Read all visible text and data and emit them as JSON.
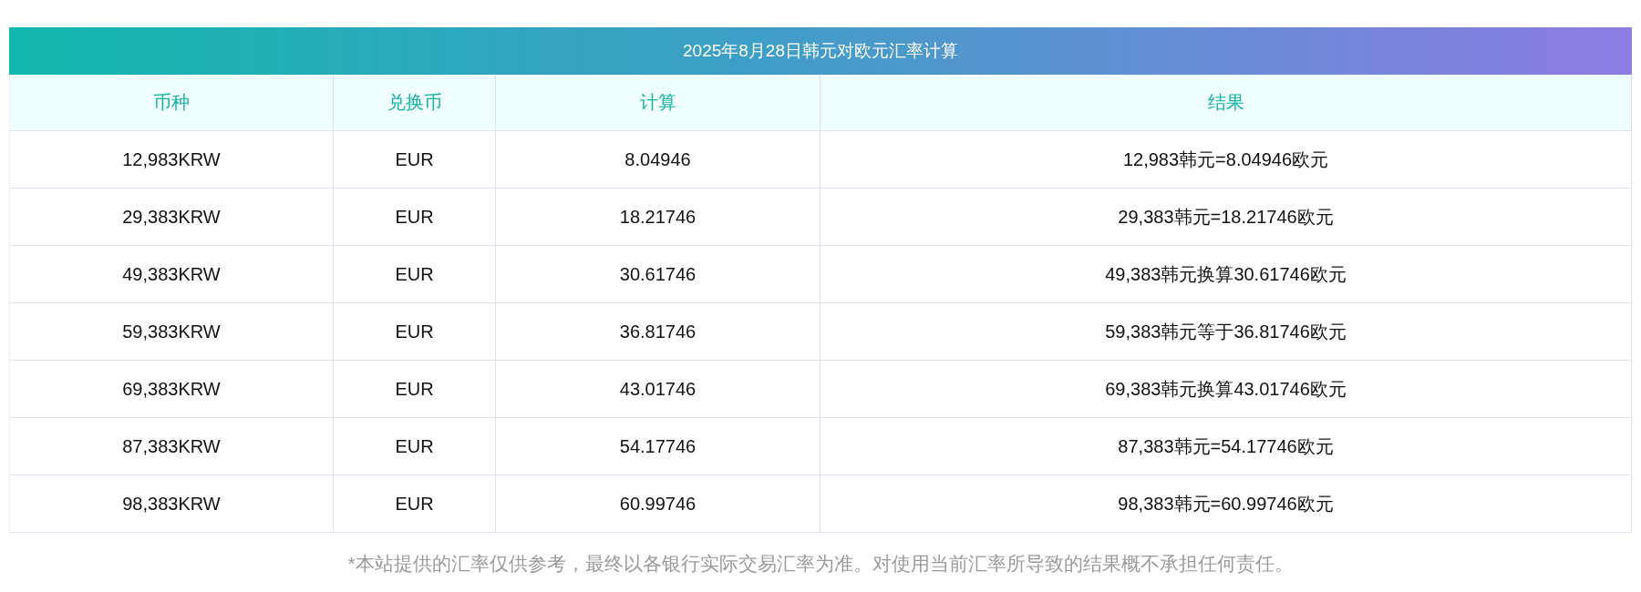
{
  "title": "2025年8月28日韩元对欧元汇率计算",
  "columns": [
    "币种",
    "兑换币",
    "计算",
    "结果"
  ],
  "rows": [
    [
      "12,983KRW",
      "EUR",
      "8.04946",
      "12,983韩元=8.04946欧元"
    ],
    [
      "29,383KRW",
      "EUR",
      "18.21746",
      "29,383韩元=18.21746欧元"
    ],
    [
      "49,383KRW",
      "EUR",
      "30.61746",
      "49,383韩元换算30.61746欧元"
    ],
    [
      "59,383KRW",
      "EUR",
      "36.81746",
      "59,383韩元等于36.81746欧元"
    ],
    [
      "69,383KRW",
      "EUR",
      "43.01746",
      "69,383韩元换算43.01746欧元"
    ],
    [
      "87,383KRW",
      "EUR",
      "54.17746",
      "87,383韩元=54.17746欧元"
    ],
    [
      "98,383KRW",
      "EUR",
      "60.99746",
      "98,383韩元=60.99746欧元"
    ]
  ],
  "footnote": "*本站提供的汇率仅供参考，最终以各银行实际交易汇率为准。对使用当前汇率所导致的结果概不承担任何责任。"
}
